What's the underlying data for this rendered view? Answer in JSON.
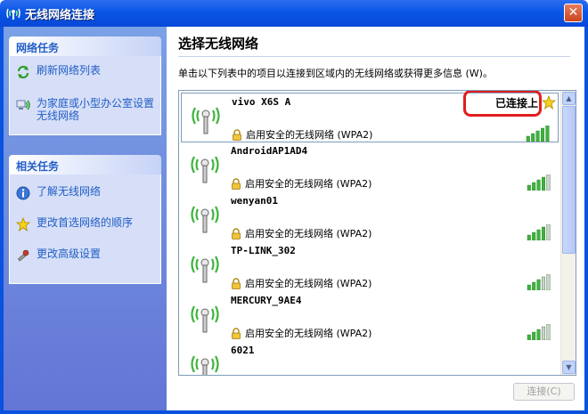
{
  "window": {
    "title": "无线网络连接",
    "close_glyph": "✕"
  },
  "sidebar": {
    "network_tasks": {
      "header": "网络任务",
      "items": [
        {
          "label": "刷新网络列表",
          "icon": "refresh-icon"
        },
        {
          "label": "为家庭或小型办公室设置无线网络",
          "icon": "setup-network-icon"
        }
      ]
    },
    "related_tasks": {
      "header": "相关任务",
      "items": [
        {
          "label": "了解无线网络",
          "icon": "info-icon"
        },
        {
          "label": "更改首选网络的顺序",
          "icon": "star-icon"
        },
        {
          "label": "更改高级设置",
          "icon": "settings-icon"
        }
      ]
    }
  },
  "main": {
    "heading": "选择无线网络",
    "instruction": "单击以下列表中的项目以连接到区域内的无线网络或获得更多信息 (W)。",
    "networks": [
      {
        "name": "vivo X6S A",
        "security": "启用安全的无线网络 (WPA2)",
        "status": "已连接上",
        "signal": 5
      },
      {
        "name": "AndroidAP1AD4",
        "security": "启用安全的无线网络 (WPA2)",
        "status": "",
        "signal": 4
      },
      {
        "name": "wenyan01",
        "security": "启用安全的无线网络 (WPA2)",
        "status": "",
        "signal": 4
      },
      {
        "name": "TP-LINK_302",
        "security": "启用安全的无线网络 (WPA2)",
        "status": "",
        "signal": 3
      },
      {
        "name": "MERCURY_9AE4",
        "security": "启用安全的无线网络 (WPA2)",
        "status": "",
        "signal": 3
      },
      {
        "name": "6021",
        "security": "",
        "status": "",
        "signal": 0
      }
    ],
    "connect_button": "连接(C)"
  },
  "colors": {
    "title_bar": "#0a56e6",
    "task_link": "#215dc6",
    "highlight_ring": "#e01e1e",
    "signal_green": "#3cb43c"
  }
}
